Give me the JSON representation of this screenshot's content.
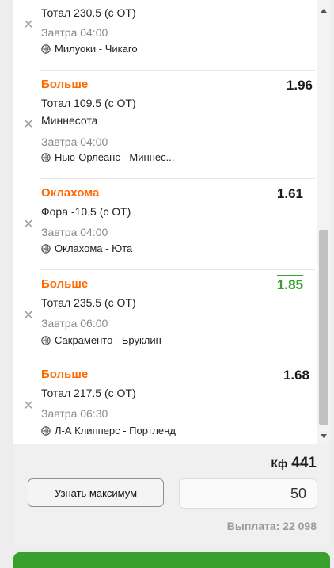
{
  "bets": [
    {
      "label": "",
      "odds": "",
      "market": "Тотал 230.5 (с ОТ)",
      "time": "Завтра 04:00",
      "match": "Милуоки - Чикаго",
      "highlight": false
    },
    {
      "label": "Больше",
      "odds": "1.96",
      "market": "Тотал 109.5 (с ОТ)",
      "extra": "Миннесота",
      "time": "Завтра 04:00",
      "match": "Нью-Орлеанс - Миннес...",
      "highlight": false
    },
    {
      "label": "Оклахома",
      "odds": "1.61",
      "market": "Фора -10.5 (с ОТ)",
      "time": "Завтра 04:00",
      "match": "Оклахома - Юта",
      "highlight": false
    },
    {
      "label": "Больше",
      "odds": "1.85",
      "market": "Тотал 235.5 (с ОТ)",
      "time": "Завтра 06:00",
      "match": "Сакраменто - Бруклин",
      "highlight": true
    },
    {
      "label": "Больше",
      "odds": "1.68",
      "market": "Тотал 217.5 (с ОТ)",
      "time": "Завтра 06:30",
      "match": "Л-А Клипперс - Портленд",
      "highlight": false
    }
  ],
  "footer": {
    "kf_label": "Кф",
    "kf_value": "441",
    "max_button": "Узнать максимум",
    "stake": "50",
    "payout": "Выплата: 22 098"
  },
  "colors": {
    "accent": "#ff6a00",
    "positive": "#3aa02d"
  },
  "icons": {
    "remove": "close-icon",
    "sport": "basketball-icon"
  }
}
